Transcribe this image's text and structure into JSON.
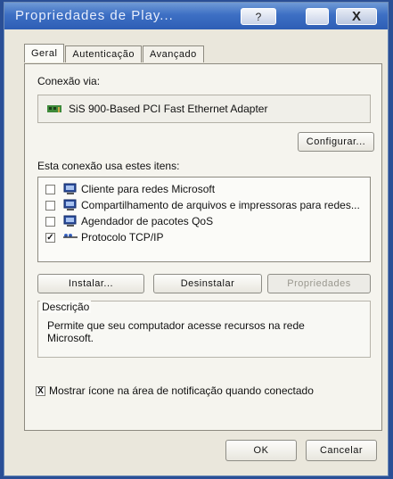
{
  "window": {
    "title": "Propriedades de Play...",
    "help_button": "?",
    "close_button": "X"
  },
  "tabs": [
    {
      "label": "Geral"
    },
    {
      "label": "Autenticação"
    },
    {
      "label": "Avançado"
    }
  ],
  "connect_using": {
    "label": "Conexão via:",
    "adapter": "SiS 900-Based PCI Fast Ethernet Adapter",
    "configure_button": "Configurar..."
  },
  "items_section": {
    "label": "Esta conexão usa estes itens:",
    "items": [
      {
        "label": "Cliente para redes Microsoft",
        "checked": false,
        "icon": "network-client-icon"
      },
      {
        "label": "Compartilhamento de arquivos e impressoras para redes...",
        "checked": false,
        "icon": "file-sharing-icon"
      },
      {
        "label": "Agendador de pacotes QoS",
        "checked": false,
        "icon": "qos-scheduler-icon"
      },
      {
        "label": "Protocolo TCP/IP",
        "checked": true,
        "icon": "protocol-icon"
      }
    ]
  },
  "actions": {
    "install": "Instalar...",
    "uninstall": "Desinstalar",
    "properties": "Propriedades"
  },
  "description": {
    "legend": "Descrição",
    "text": "Permite que seu computador acesse recursos na rede Microsoft."
  },
  "notify": {
    "checkbox": "X",
    "label": "Mostrar ícone na área de notificação quando conectado"
  },
  "footer": {
    "ok": "OK",
    "cancel": "Cancelar"
  }
}
